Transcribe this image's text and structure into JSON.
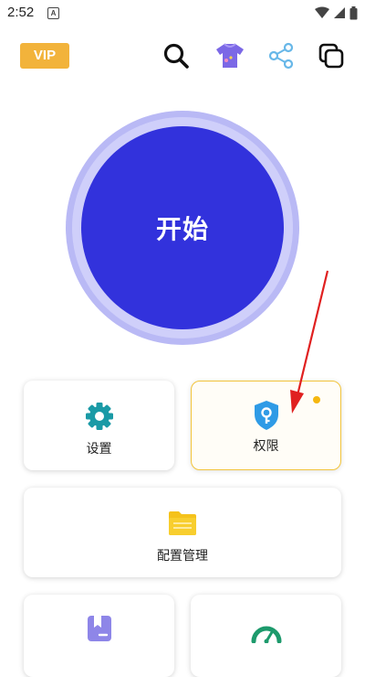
{
  "status_bar": {
    "time": "2:52",
    "notification_icon": "a-icon",
    "indicators": [
      "wifi-icon",
      "signal-icon",
      "battery-icon"
    ]
  },
  "toolbar": {
    "vip_label": "VIP",
    "icons": [
      "search-icon",
      "theme-shirt-icon",
      "share-icon",
      "copy-icon"
    ]
  },
  "main": {
    "start_label": "开始"
  },
  "cards": {
    "settings": {
      "label": "设置",
      "icon": "gear-icon"
    },
    "permissions": {
      "label": "权限",
      "icon": "shield-key-icon",
      "has_badge": true
    },
    "config_manager": {
      "label": "配置管理",
      "icon": "folder-icon"
    },
    "bottom_left": {
      "label": "",
      "icon": "bookmark-box-icon"
    },
    "bottom_right": {
      "label": "",
      "icon": "speedometer-icon"
    }
  },
  "colors": {
    "vip": "#f2b33b",
    "start_button": "#3232dc",
    "start_ring": "#b9b9f5",
    "teal_icon": "#1a9aa6",
    "shield_icon": "#2f9be6",
    "folder_icon": "#f5c21b",
    "active_border": "#f2c43b",
    "badge_dot": "#f5b70f",
    "annotation_arrow": "#e02020"
  }
}
